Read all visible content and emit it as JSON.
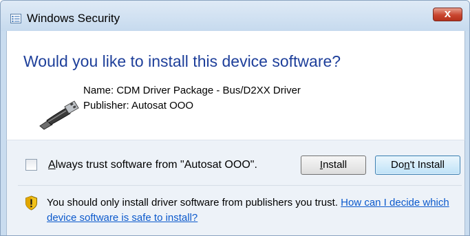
{
  "window": {
    "title": "Windows Security",
    "close_glyph": "x"
  },
  "dialog": {
    "heading": "Would you like to install this device software?",
    "name_line": "Name: CDM Driver Package - Bus/D2XX Driver",
    "publisher_line": "Publisher: Autosat OOO",
    "device_icon": "usb-device-icon"
  },
  "trust": {
    "checkbox_checked": false,
    "label_accel": "A",
    "label_rest": "lways trust software from \"Autosat OOO\"."
  },
  "buttons": {
    "install_accel": "I",
    "install_rest": "nstall",
    "dont_before": "Do",
    "dont_accel": "n",
    "dont_after": "'t Install"
  },
  "footer": {
    "shield_icon": "shield-warning-icon",
    "warning_text": "You should only install driver software from publishers you trust. ",
    "link_text": "How can I decide which device software is safe to install?"
  },
  "colors": {
    "heading": "#1e3f9a",
    "link": "#0b59cc",
    "close_button": "#c9452f"
  }
}
